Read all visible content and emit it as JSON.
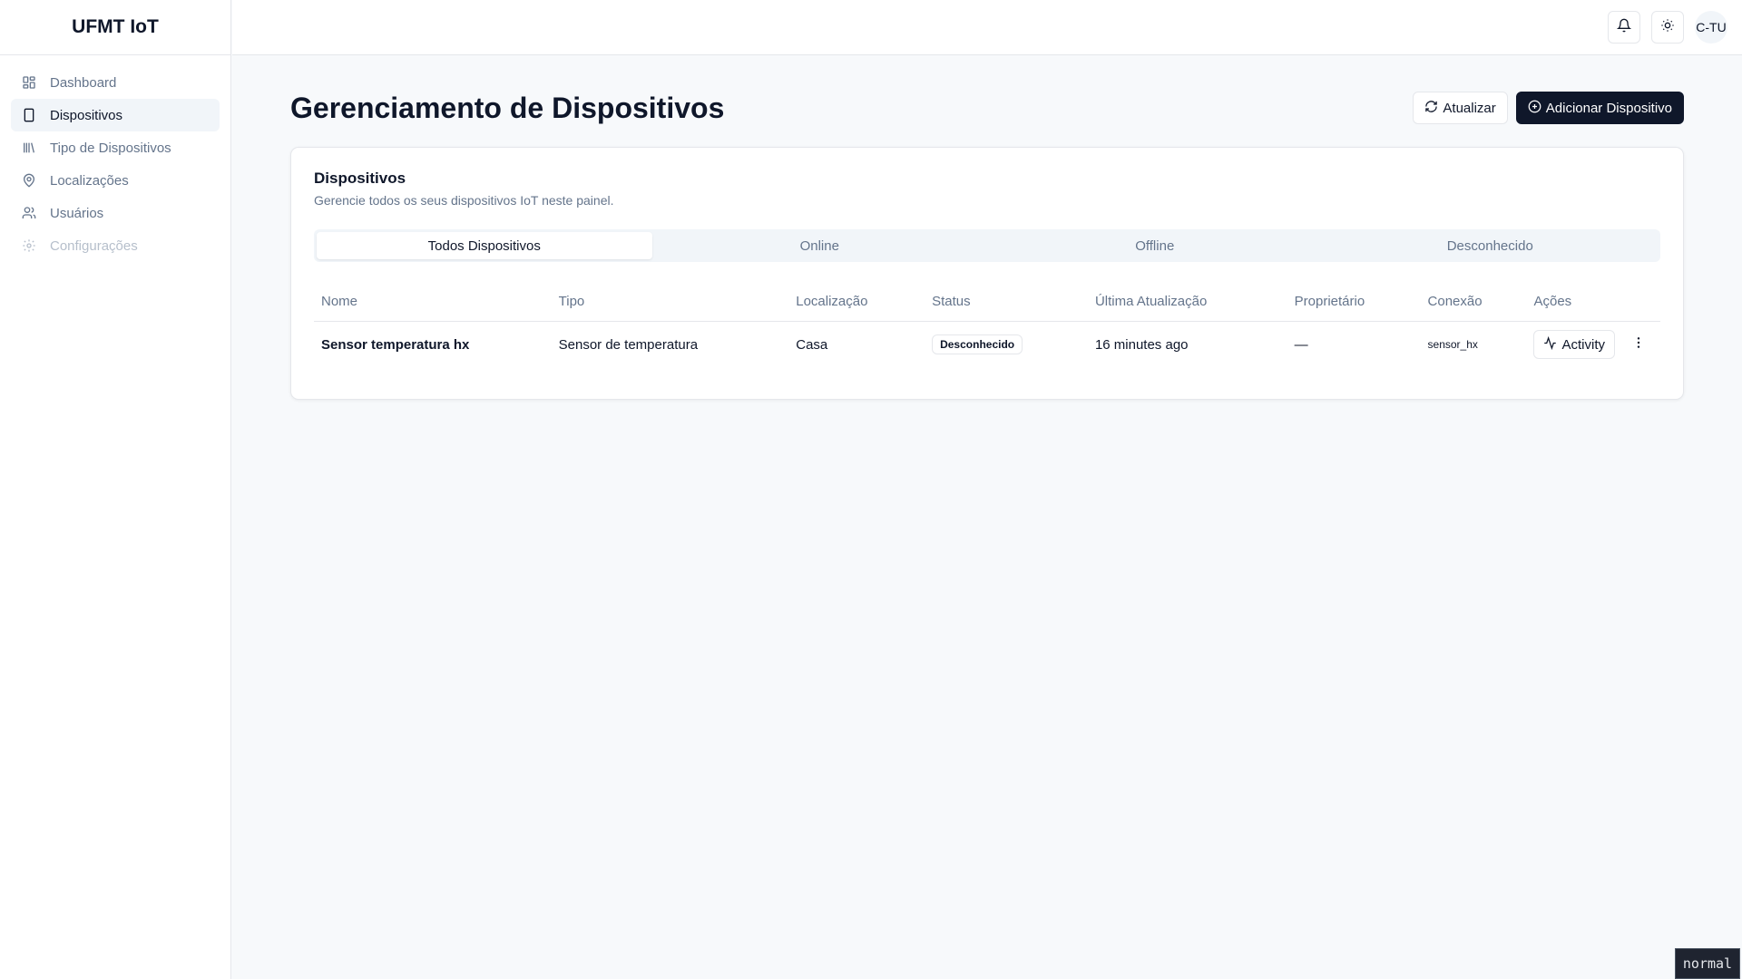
{
  "app": {
    "brand": "UFMT IoT"
  },
  "sidebar": {
    "items": [
      {
        "label": "Dashboard",
        "icon": "dashboard-icon"
      },
      {
        "label": "Dispositivos",
        "icon": "tablet-icon"
      },
      {
        "label": "Tipo de Dispositivos",
        "icon": "library-icon"
      },
      {
        "label": "Localizações",
        "icon": "map-pin-icon"
      },
      {
        "label": "Usuários",
        "icon": "users-icon"
      },
      {
        "label": "Configurações",
        "icon": "gear-icon"
      }
    ],
    "active_index": 1
  },
  "topbar": {
    "avatar_initials": "C-TU"
  },
  "page": {
    "title": "Gerenciamento de Dispositivos",
    "refresh_label": "Atualizar",
    "add_label": "Adicionar Dispositivo"
  },
  "card": {
    "title": "Dispositivos",
    "description": "Gerencie todos os seus dispositivos IoT neste painel."
  },
  "tabs": [
    "Todos Dispositivos",
    "Online",
    "Offline",
    "Desconhecido"
  ],
  "table": {
    "columns": [
      "Nome",
      "Tipo",
      "Localização",
      "Status",
      "Última Atualização",
      "Proprietário",
      "Conexão",
      "Ações"
    ],
    "rows": [
      {
        "nome": "Sensor temperatura hx",
        "tipo": "Sensor de temperatura",
        "localizacao": "Casa",
        "status": "Desconhecido",
        "atualizacao": "16 minutes ago",
        "proprietario": "—",
        "conexao": "sensor_hx",
        "activity_label": "Activity"
      }
    ]
  },
  "mode_indicator": "normal",
  "colors": {
    "primary": "#0f172a",
    "muted": "#64748b",
    "border": "#e5e7eb"
  }
}
